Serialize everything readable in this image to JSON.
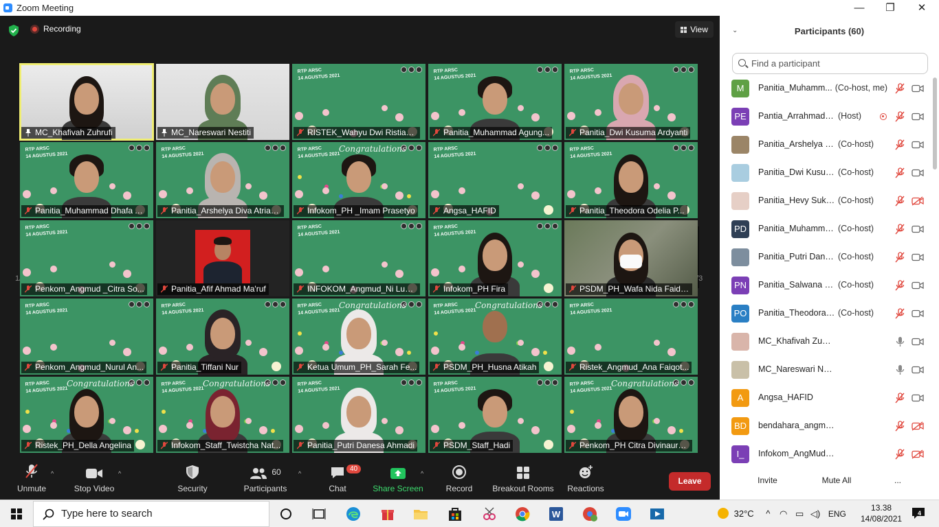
{
  "window": {
    "title": "Zoom Meeting",
    "minimize": "—",
    "maximize": "❐",
    "close": "✕"
  },
  "topbar": {
    "recording_label": "Recording",
    "view_label": "View"
  },
  "pager": {
    "left": "1/3",
    "right": "1/3"
  },
  "tiles": [
    {
      "name": "MC_Khafivah Zuhrufi",
      "mic": "pinned",
      "bg": "photo1",
      "person": "hair-long",
      "speaking": true
    },
    {
      "name": "MC_Nareswari Nestiti",
      "mic": "pinned",
      "bg": "photo2",
      "person": "hijab-green"
    },
    {
      "name": "RISTEK_Wahyu Dwi Ristiani...",
      "mic": "muted",
      "bg": "flowers",
      "person": "none"
    },
    {
      "name": "Panitia_Muhammad Agung...",
      "mic": "muted",
      "bg": "flowers",
      "person": "hair-short"
    },
    {
      "name": "Panitia_Dwi Kusuma Ardyanti",
      "mic": "muted",
      "bg": "flowers",
      "person": "hijab-pink"
    },
    {
      "name": "Panitia_Muhammad Dhafa A...",
      "mic": "muted",
      "bg": "flowers",
      "person": "hair-short"
    },
    {
      "name": "Panitia_Arshelya Diva Atria P...",
      "mic": "muted",
      "bg": "flowers",
      "person": "hijab-grey"
    },
    {
      "name": "Infokom_PH _Imam Prasetyo",
      "mic": "muted",
      "bg": "congrats",
      "person": "hair-short"
    },
    {
      "name": "Angsa_HAFID",
      "mic": "muted",
      "bg": "flowers",
      "person": "none"
    },
    {
      "name": "Panitia_Theodora Odelia P...",
      "mic": "muted",
      "bg": "flowers",
      "person": "hair-long"
    },
    {
      "name": "Penkom_Angmud _Citra So...",
      "mic": "muted",
      "bg": "flowers",
      "person": "none"
    },
    {
      "name": "Panitia_Afif Ahmad Ma'ruf",
      "mic": "muted",
      "bg": "dark",
      "person": "redphoto"
    },
    {
      "name": "INFOKOM_Angmud_Ni Luh ...",
      "mic": "muted",
      "bg": "flowers",
      "person": "none"
    },
    {
      "name": "Infokom_PH Fira",
      "mic": "muted",
      "bg": "flowers",
      "person": "hair-long"
    },
    {
      "name": "PSDM_PH_Wafa Nida Faida...",
      "mic": "muted",
      "bg": "wood",
      "person": "mask"
    },
    {
      "name": "Penkom_Angmud_Nurul An...",
      "mic": "muted",
      "bg": "flowers",
      "person": "none"
    },
    {
      "name": "Panitia_Tiffani Nur",
      "mic": "muted",
      "bg": "flowers",
      "person": "hijab-dark"
    },
    {
      "name": "Ketua Umum_PH_Sarah Fe...",
      "mic": "muted",
      "bg": "congrats",
      "person": "hijab-white"
    },
    {
      "name": "PSDM_PH_Husna Atikah",
      "mic": "muted",
      "bg": "congrats",
      "person": "bald"
    },
    {
      "name": "Ristek_Angmud_Ana Faiqot...",
      "mic": "muted",
      "bg": "flowers",
      "person": "none"
    },
    {
      "name": "Ristek_PH_Della Angelina",
      "mic": "muted",
      "bg": "congrats",
      "person": "hair-long"
    },
    {
      "name": "Infokom_Staff_Twistcha Nat...",
      "mic": "muted",
      "bg": "congrats",
      "person": "hair-red"
    },
    {
      "name": "Panitia_Putri Danesa Ahmadi",
      "mic": "muted",
      "bg": "flowers",
      "person": "hijab-white"
    },
    {
      "name": "PSDM_Staff_Hadi",
      "mic": "muted",
      "bg": "flowers",
      "person": "hair-short"
    },
    {
      "name": "Penkom_PH Citra Divinaura...",
      "mic": "muted",
      "bg": "congrats",
      "person": "hair-long"
    }
  ],
  "tile_bg_text": {
    "line1": "RTP ARSC",
    "line2": "14 AGUSTUS 2021",
    "congrats": "Congratulations"
  },
  "toolbar": {
    "unmute": "Unmute",
    "stop_video": "Stop Video",
    "security": "Security",
    "participants": "Participants",
    "participants_count": "60",
    "chat": "Chat",
    "chat_badge": "40",
    "share_screen": "Share Screen",
    "record": "Record",
    "breakout_rooms": "Breakout Rooms",
    "reactions": "Reactions",
    "leave": "Leave"
  },
  "panel": {
    "title": "Participants (60)",
    "search_placeholder": "Find a participant",
    "participants": [
      {
        "initials": "M",
        "color": "#5fa045",
        "name": "Panitia_Muhamm...",
        "role": "(Co-host, me)",
        "mic": "muted",
        "cam": "on"
      },
      {
        "initials": "PE",
        "color": "#7b3fb5",
        "name": "Pantia_Arrahmadiana...",
        "role": "(Host)",
        "mic": "muted",
        "cam": "on",
        "recording": true
      },
      {
        "initials": "",
        "color": "#9b8567",
        "name": "Panitia_Arshelya Diva ...",
        "role": "(Co-host)",
        "mic": "muted",
        "cam": "on"
      },
      {
        "initials": "",
        "color": "#a9cde0",
        "name": "Panitia_Dwi Kusuma A...",
        "role": "(Co-host)",
        "mic": "muted",
        "cam": "on"
      },
      {
        "initials": "",
        "color": "#e6cfc6",
        "name": "Panitia_Hevy Sukma Al...",
        "role": "(Co-host)",
        "mic": "muted",
        "cam": "off"
      },
      {
        "initials": "PD",
        "color": "#2f3f55",
        "name": "Panitia_Muhammad D...",
        "role": "(Co-host)",
        "mic": "muted",
        "cam": "on"
      },
      {
        "initials": "",
        "color": "#7d8e9e",
        "name": "Panitia_Putri Danesa A...",
        "role": "(Co-host)",
        "mic": "muted",
        "cam": "on"
      },
      {
        "initials": "PN",
        "color": "#7b3fb5",
        "name": "Panitia_Salwana Nabil...",
        "role": "(Co-host)",
        "mic": "muted",
        "cam": "on"
      },
      {
        "initials": "PO",
        "color": "#2a7fc4",
        "name": "Panitia_Theodora Od...",
        "role": "(Co-host)",
        "mic": "muted",
        "cam": "on"
      },
      {
        "initials": "",
        "color": "#d9b5aa",
        "name": "MC_Khafivah Zuhrufi",
        "role": "",
        "mic": "on",
        "cam": "on"
      },
      {
        "initials": "",
        "color": "#c9c0a8",
        "name": "MC_Nareswari Nestiti",
        "role": "",
        "mic": "on",
        "cam": "on"
      },
      {
        "initials": "A",
        "color": "#f29a11",
        "name": "Angsa_HAFID",
        "role": "",
        "mic": "muted",
        "cam": "on"
      },
      {
        "initials": "BD",
        "color": "#f29a11",
        "name": "bendahara_angmud_Radha Dha",
        "role": "",
        "mic": "muted",
        "cam": "off"
      },
      {
        "initials": "I_",
        "color": "#7b3fb5",
        "name": "Infokom_AngMud _Ovi",
        "role": "",
        "mic": "muted",
        "cam": "off"
      }
    ],
    "invite": "Invite",
    "mute_all": "Mute All",
    "more": "..."
  },
  "taskbar": {
    "search_placeholder": "Type here to search",
    "weather": "32°C",
    "lang": "ENG",
    "time": "13.38",
    "date": "14/08/2021",
    "notifications": "4"
  }
}
